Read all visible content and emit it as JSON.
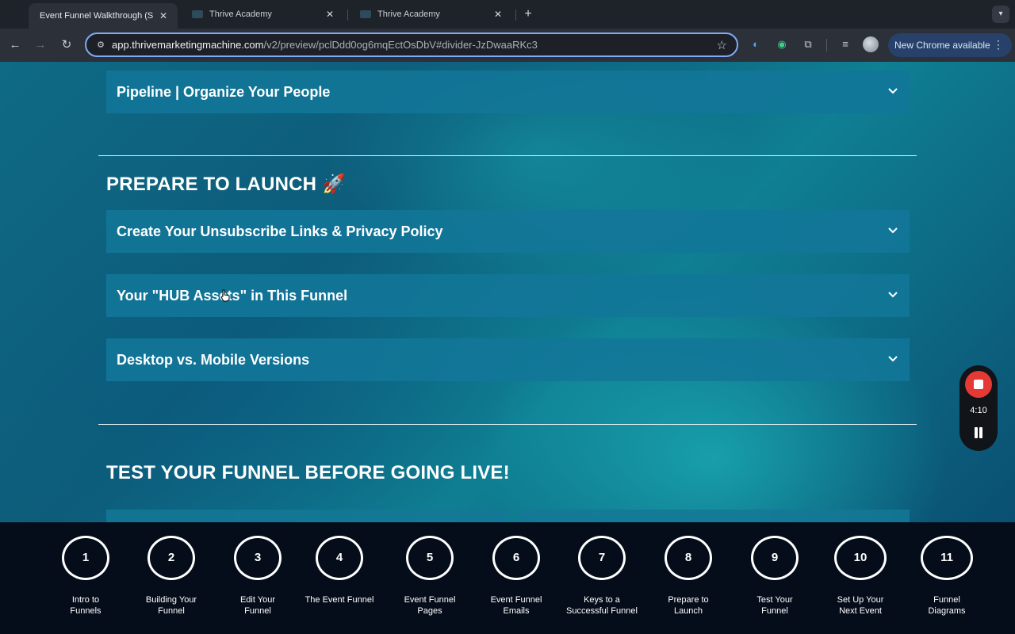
{
  "browser": {
    "tabs": [
      {
        "title": "Event Funnel Walkthrough (S",
        "active": true
      },
      {
        "title": "Thrive Academy",
        "active": false
      },
      {
        "title": "Thrive Academy",
        "active": false
      }
    ],
    "url_host": "app.thrivemarketingmachine.com",
    "url_path": "/v2/preview/pclDdd0og6mqEctOsDbV#divider-JzDwaaRKc3",
    "update_label": "New Chrome available"
  },
  "page": {
    "accordions_top": [
      {
        "title": "Pipeline | Organize Your People"
      }
    ],
    "section_launch": {
      "heading": "PREPARE TO LAUNCH 🚀",
      "accordions": [
        {
          "title": "Create Your Unsubscribe Links & Privacy Policy"
        },
        {
          "title": "Your \"HUB Assets\" in This Funnel"
        },
        {
          "title": "Desktop vs. Mobile Versions"
        }
      ]
    },
    "section_test": {
      "heading": "TEST YOUR FUNNEL BEFORE GOING LIVE!"
    }
  },
  "recorder": {
    "time": "4:10"
  },
  "steps": [
    {
      "number": "1",
      "label": "Intro to\nFunnels"
    },
    {
      "number": "2",
      "label": "Building Your\nFunnel"
    },
    {
      "number": "3",
      "label": "Edit Your\nFunnel"
    },
    {
      "number": "4",
      "label": "The Event Funnel"
    },
    {
      "number": "5",
      "label": "Event Funnel\nPages"
    },
    {
      "number": "6",
      "label": "Event Funnel\nEmails"
    },
    {
      "number": "7",
      "label": "Keys to a\nSuccessful Funnel"
    },
    {
      "number": "8",
      "label": "Prepare to\nLaunch"
    },
    {
      "number": "9",
      "label": "Test Your\nFunnel"
    },
    {
      "number": "10",
      "label": "Set Up Your\nNext Event"
    },
    {
      "number": "11",
      "label": "Funnel\nDiagrams"
    }
  ],
  "colors": {
    "accordion_bg": "#1276a0",
    "nav_bg": "#050d1a",
    "record_red": "#e53935",
    "omnibox_focus": "#7faaf5"
  }
}
